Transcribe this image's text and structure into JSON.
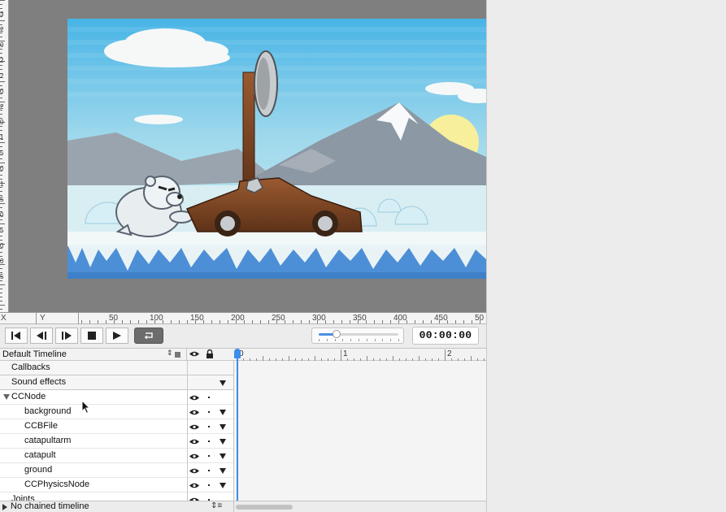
{
  "canvas": {
    "background": "#7f7f7f",
    "left_ruler_labels": [
      "3",
      "2",
      "0",
      "2",
      "2",
      "0",
      "2",
      "0",
      "1",
      "5",
      "0",
      "1",
      "5",
      "0",
      "5",
      "0",
      "0",
      "5"
    ],
    "scene_colors": {
      "sky_top": "#4db8e6",
      "sky_bottom": "#cdeef2",
      "snow": "#f2f7f8",
      "ice_water": "#4d8fd6",
      "sun": "#f7ef9c",
      "mountain": "#8f9aa6",
      "wood": "#7a4424"
    }
  },
  "ruler": {
    "x_label": "X",
    "y_label": "Y",
    "ticks": [
      "50",
      "100",
      "150",
      "200",
      "250",
      "300",
      "350",
      "400",
      "450",
      "50"
    ]
  },
  "playback": {
    "buttons": [
      "skip-to-start-icon",
      "step-back-icon",
      "step-forward-icon",
      "stop-icon",
      "play-icon",
      "loop-icon"
    ],
    "loop_active": true,
    "speed_fraction": 0.22,
    "timecode": "00:00:00"
  },
  "timeline": {
    "selector_label": "Default Timeline",
    "scale_labels": [
      "0",
      "1",
      "2"
    ],
    "playhead_seconds": 0,
    "accent_color": "#3b8ee8",
    "rows": [
      {
        "label": "Callbacks",
        "type": "section",
        "eye": false,
        "lock_dot": false,
        "menu": false
      },
      {
        "label": "Sound effects",
        "type": "section",
        "eye": false,
        "lock_dot": false,
        "menu": true
      },
      {
        "label": "CCNode",
        "type": "node",
        "eye": true,
        "lock_dot": true,
        "menu": false
      },
      {
        "label": "background",
        "type": "child",
        "eye": true,
        "lock_dot": true,
        "menu": true
      },
      {
        "label": "CCBFile",
        "type": "child",
        "eye": true,
        "lock_dot": true,
        "menu": true
      },
      {
        "label": "catapultarm",
        "type": "child",
        "eye": true,
        "lock_dot": true,
        "menu": true
      },
      {
        "label": "catapult",
        "type": "child",
        "eye": true,
        "lock_dot": true,
        "menu": true
      },
      {
        "label": "ground",
        "type": "child",
        "eye": true,
        "lock_dot": true,
        "menu": true
      },
      {
        "label": "CCPhysicsNode",
        "type": "child",
        "eye": true,
        "lock_dot": true,
        "menu": true
      },
      {
        "label": "Joints",
        "type": "node",
        "eye": true,
        "lock_dot": true,
        "menu": false
      }
    ],
    "footer_label": "No chained timeline"
  }
}
